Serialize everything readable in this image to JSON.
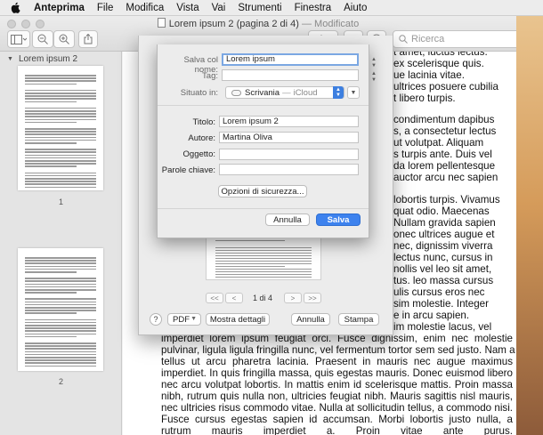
{
  "menubar": {
    "apple": "",
    "items": [
      "Anteprima",
      "File",
      "Modifica",
      "Vista",
      "Vai",
      "Strumenti",
      "Finestra",
      "Aiuto"
    ]
  },
  "window": {
    "title": "Lorem ipsum 2 (pagina 2 di 4)",
    "title_suffix": "— Modificato",
    "search_placeholder": "Ricerca"
  },
  "sidebar": {
    "section_title": "Lorem ipsum 2",
    "pages": [
      "1",
      "2"
    ]
  },
  "document": {
    "lines": [
      "t amet, luctus lectus.",
      "ex scelerisque quis.",
      "ue lacinia vitae.",
      "ultrices posuere cubilia",
      "t libero turpis.",
      "condimentum dapibus",
      "s, a consectetur lectus",
      "ut volutpat. Aliquam",
      "s turpis ante. Duis vel",
      "da lorem pellentesque",
      "auctor arcu nec sapien",
      "lobortis turpis. Vivamus",
      "quat odio. Maecenas",
      "Nullam gravida sapien",
      "onec ultrices augue et",
      "nec, dignissim viverra",
      "lectus nunc, cursus in",
      "nollis vel leo sit amet,",
      "tus. leo massa cursus",
      "ulis cursus eros nec",
      "sim molestie. Integer",
      "e in arcu sapien.",
      "im molestie lacus, vel",
      "imperdiet lorem ipsum feugiat orci. Fusce dignissim, enim nec molestie",
      "pulvinar, ligula ligula fringilla nunc, vel fermentum tortor sem sed justo. Nam a",
      "tellus ut arcu pharetra lacinia. Praesent in mauris nec augue maximus",
      "imperdiet. In quis fringilla massa, quis egestas mauris. Donec euismod libero",
      "nec arcu volutpat lobortis. In mattis enim id scelerisque mattis. Proin massa",
      "nibh, rutrum quis nulla non, ultricies feugiat nibh. Mauris sagittis nisl mauris,",
      "nec ultricies risus commodo vitae. Nulla at sollicitudin tellus, a commodo nisi.",
      "Fusce cursus egestas sapien id accumsan. Morbi lobortis justo nulla, a",
      "rutrum mauris imperdiet a. Proin vitae ante purus."
    ]
  },
  "save_dialog": {
    "save_as_label": "Salva col nome:",
    "save_as_value": "Lorem ipsum",
    "tags_label": "Tag:",
    "where_label": "Situato in:",
    "where_value": "Scrivania",
    "where_sub": "iCloud",
    "title_label": "Titolo:",
    "title_value": "Lorem ipsum 2",
    "author_label": "Autore:",
    "author_value": "Martina Oliva",
    "subject_label": "Oggetto:",
    "keywords_label": "Parole chiave:",
    "security_button": "Opzioni di sicurezza...",
    "cancel_button": "Annulla",
    "save_button": "Salva"
  },
  "print_dialog": {
    "page_indicator": "1 di 4",
    "help": "?",
    "pdf_button": "PDF",
    "details_button": "Mostra dettagli",
    "cancel_button": "Annulla",
    "print_button": "Stampa"
  }
}
